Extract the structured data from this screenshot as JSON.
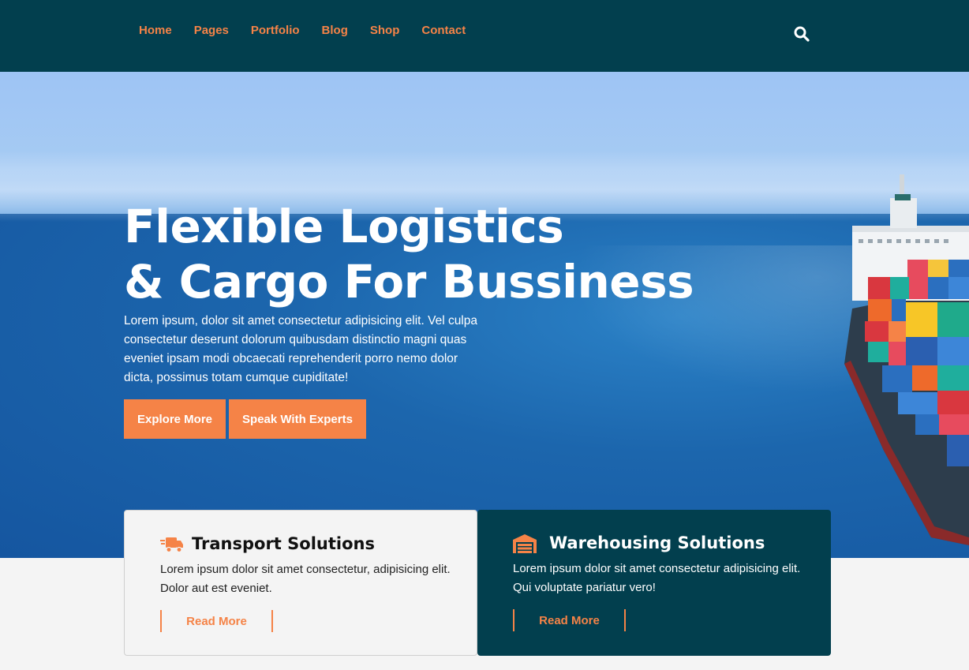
{
  "nav": {
    "items": [
      {
        "label": "Home"
      },
      {
        "label": "Pages"
      },
      {
        "label": "Portfolio"
      },
      {
        "label": "Blog"
      },
      {
        "label": "Shop"
      },
      {
        "label": "Contact"
      }
    ],
    "search_icon": "search-icon"
  },
  "hero": {
    "title_line1": "Flexible Logistics",
    "title_line2": "& Cargo For Bussiness",
    "text": "Lorem ipsum, dolor sit amet consectetur adipisicing elit. Vel culpa consectetur deserunt dolorum quibusdam distinctio magni quas eveniet ipsam modi obcaecati reprehenderit porro nemo dolor dicta, possimus totam cumque cupiditate!",
    "button_primary": "Explore More",
    "button_secondary": "Speak With Experts"
  },
  "cards": [
    {
      "icon": "truck-icon",
      "title": "Transport Solutions",
      "text": "Lorem ipsum dolor sit amet consectetur, adipisicing elit. Dolor aut est eveniet.",
      "link": "Read More"
    },
    {
      "icon": "warehouse-icon",
      "title": "Warehousing Solutions",
      "text": "Lorem ipsum dolor sit amet consectetur adipisicing elit. Qui voluptate pariatur vero!",
      "link": "Read More"
    }
  ],
  "colors": {
    "navy": "#023f4e",
    "accent": "#f58347"
  }
}
